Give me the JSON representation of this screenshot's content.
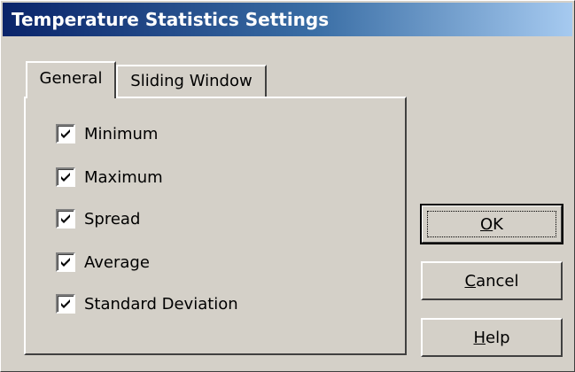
{
  "window": {
    "title": "Temperature Statistics Settings"
  },
  "tabs": [
    {
      "label": "General",
      "selected": true
    },
    {
      "label": "Sliding Window",
      "selected": false
    }
  ],
  "checkboxes": [
    {
      "label": "Minimum",
      "checked": true
    },
    {
      "label": "Maximum",
      "checked": true
    },
    {
      "label": "Spread",
      "checked": true
    },
    {
      "label": "Average",
      "checked": true
    },
    {
      "label": "Standard Deviation",
      "checked": true
    }
  ],
  "buttons": {
    "ok": {
      "mnemonic": "O",
      "rest": "K"
    },
    "cancel": {
      "mnemonic": "C",
      "rest": "ancel"
    },
    "help": {
      "mnemonic": "H",
      "rest": "elp"
    }
  },
  "colors": {
    "face": "#d4d0c8",
    "title_start": "#0a246a",
    "title_end": "#a6caf0"
  }
}
